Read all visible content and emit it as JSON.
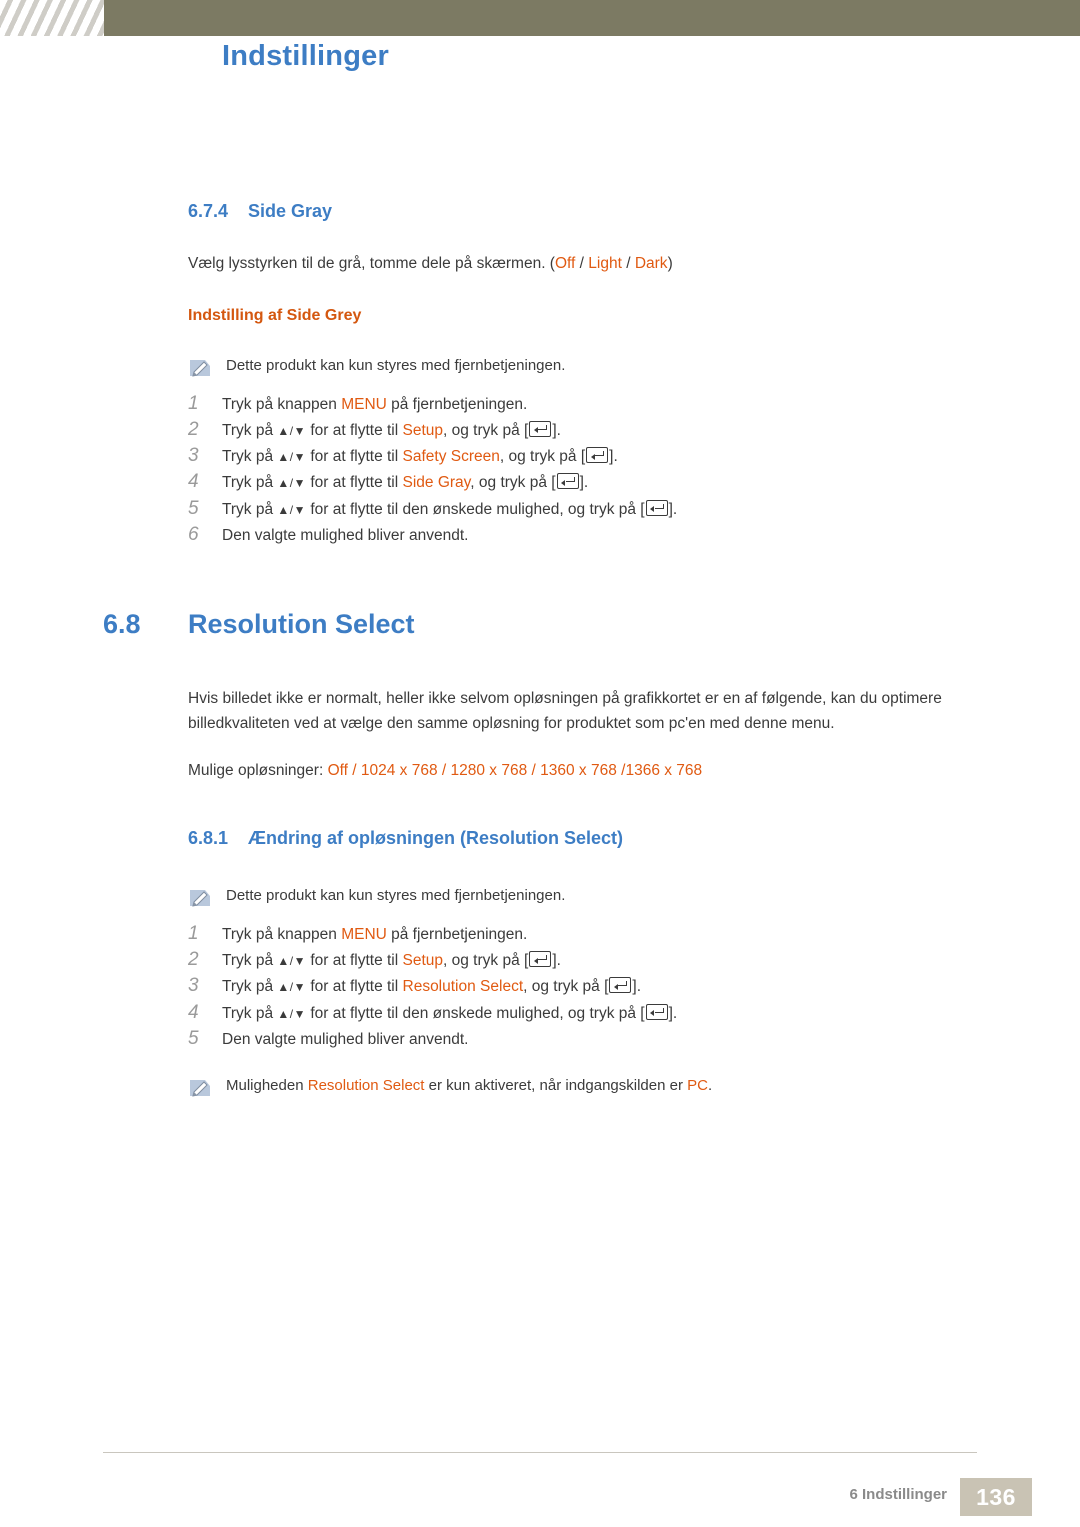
{
  "header": {
    "title": "Indstillinger"
  },
  "sections": {
    "side_gray": {
      "number": "6.7.4",
      "title": "Side Gray",
      "intro_prefix": "Vælg lysstyrken til de grå, tomme dele på skærmen. (",
      "intro_opt1": "Off",
      "intro_sep1": " / ",
      "intro_opt2": "Light",
      "intro_sep2": " / ",
      "intro_opt3": "Dark",
      "intro_suffix": ")",
      "subhead": "Indstilling af Side Grey",
      "note": "Dette produkt kan kun styres med fjernbetjeningen.",
      "steps": [
        {
          "num": "1",
          "parts": [
            {
              "t": "Tryk på knappen ",
              "c": "plain"
            },
            {
              "t": "MENU",
              "c": "orange"
            },
            {
              "t": " på fjernbetjeningen.",
              "c": "plain"
            }
          ]
        },
        {
          "num": "2",
          "parts": [
            {
              "t": "Tryk på ",
              "c": "plain"
            },
            {
              "t": "▲/▼",
              "c": "arrows"
            },
            {
              "t": " for at flytte til ",
              "c": "plain"
            },
            {
              "t": "Setup",
              "c": "orange"
            },
            {
              "t": ", og tryk på [",
              "c": "plain"
            },
            {
              "t": "",
              "c": "key"
            },
            {
              "t": "].",
              "c": "plain"
            }
          ]
        },
        {
          "num": "3",
          "parts": [
            {
              "t": "Tryk på ",
              "c": "plain"
            },
            {
              "t": "▲/▼",
              "c": "arrows"
            },
            {
              "t": " for at flytte til ",
              "c": "plain"
            },
            {
              "t": "Safety Screen",
              "c": "orange"
            },
            {
              "t": ", og tryk på [",
              "c": "plain"
            },
            {
              "t": "",
              "c": "key"
            },
            {
              "t": "].",
              "c": "plain"
            }
          ]
        },
        {
          "num": "4",
          "parts": [
            {
              "t": "Tryk på ",
              "c": "plain"
            },
            {
              "t": "▲/▼",
              "c": "arrows"
            },
            {
              "t": " for at flytte til ",
              "c": "plain"
            },
            {
              "t": "Side Gray",
              "c": "orange"
            },
            {
              "t": ", og tryk på [",
              "c": "plain"
            },
            {
              "t": "",
              "c": "key"
            },
            {
              "t": "].",
              "c": "plain"
            }
          ]
        },
        {
          "num": "5",
          "parts": [
            {
              "t": "Tryk på ",
              "c": "plain"
            },
            {
              "t": "▲/▼",
              "c": "arrows"
            },
            {
              "t": " for at flytte til den ønskede mulighed, og tryk på [",
              "c": "plain"
            },
            {
              "t": "",
              "c": "key"
            },
            {
              "t": "].",
              "c": "plain"
            }
          ]
        },
        {
          "num": "6",
          "parts": [
            {
              "t": "Den valgte mulighed bliver anvendt.",
              "c": "plain"
            }
          ]
        }
      ]
    },
    "resolution_select": {
      "number": "6.8",
      "title": "Resolution Select",
      "paragraph": "Hvis billedet ikke er normalt, heller ikke selvom opløsningen på grafikkortet er en af følgende, kan du optimere billedkvaliteten ved at vælge den samme opløsning for produktet som pc'en med denne menu.",
      "options_label": "Mulige opløsninger: ",
      "options_value": "Off / 1024 x 768 / 1280 x 768 / 1360 x 768 /1366 x 768",
      "sub": {
        "number": "6.8.1",
        "title": "Ændring af opløsningen (Resolution Select)",
        "note": "Dette produkt kan kun styres med fjernbetjeningen.",
        "steps": [
          {
            "num": "1",
            "parts": [
              {
                "t": "Tryk på knappen ",
                "c": "plain"
              },
              {
                "t": "MENU",
                "c": "orange"
              },
              {
                "t": " på fjernbetjeningen.",
                "c": "plain"
              }
            ]
          },
          {
            "num": "2",
            "parts": [
              {
                "t": "Tryk på ",
                "c": "plain"
              },
              {
                "t": "▲/▼",
                "c": "arrows"
              },
              {
                "t": " for at flytte til ",
                "c": "plain"
              },
              {
                "t": "Setup",
                "c": "orange"
              },
              {
                "t": ", og tryk på [",
                "c": "plain"
              },
              {
                "t": "",
                "c": "key"
              },
              {
                "t": "].",
                "c": "plain"
              }
            ]
          },
          {
            "num": "3",
            "parts": [
              {
                "t": "Tryk på ",
                "c": "plain"
              },
              {
                "t": "▲/▼",
                "c": "arrows"
              },
              {
                "t": " for at flytte til ",
                "c": "plain"
              },
              {
                "t": "Resolution Select",
                "c": "orange"
              },
              {
                "t": ", og tryk på [",
                "c": "plain"
              },
              {
                "t": "",
                "c": "key"
              },
              {
                "t": "].",
                "c": "plain"
              }
            ]
          },
          {
            "num": "4",
            "parts": [
              {
                "t": "Tryk på ",
                "c": "plain"
              },
              {
                "t": "▲/▼",
                "c": "arrows"
              },
              {
                "t": " for at flytte til den ønskede mulighed, og tryk på [",
                "c": "plain"
              },
              {
                "t": "",
                "c": "key"
              },
              {
                "t": "].",
                "c": "plain"
              }
            ]
          },
          {
            "num": "5",
            "parts": [
              {
                "t": "Den valgte mulighed bliver anvendt.",
                "c": "plain"
              }
            ]
          }
        ],
        "footnote_parts": [
          {
            "t": "Muligheden ",
            "c": "plain"
          },
          {
            "t": "Resolution Select",
            "c": "orange"
          },
          {
            "t": " er kun aktiveret, når indgangskilden er ",
            "c": "plain"
          },
          {
            "t": "PC",
            "c": "orange"
          },
          {
            "t": ".",
            "c": "plain"
          }
        ]
      }
    }
  },
  "footer": {
    "label": "6 Indstillinger",
    "page": "136"
  },
  "colors": {
    "heading_blue": "#3d7dc4",
    "accent_orange": "#e05a12",
    "subhead_orange": "#d4570f",
    "header_band": "#7c7a63",
    "page_box": "#c9c3b4"
  }
}
